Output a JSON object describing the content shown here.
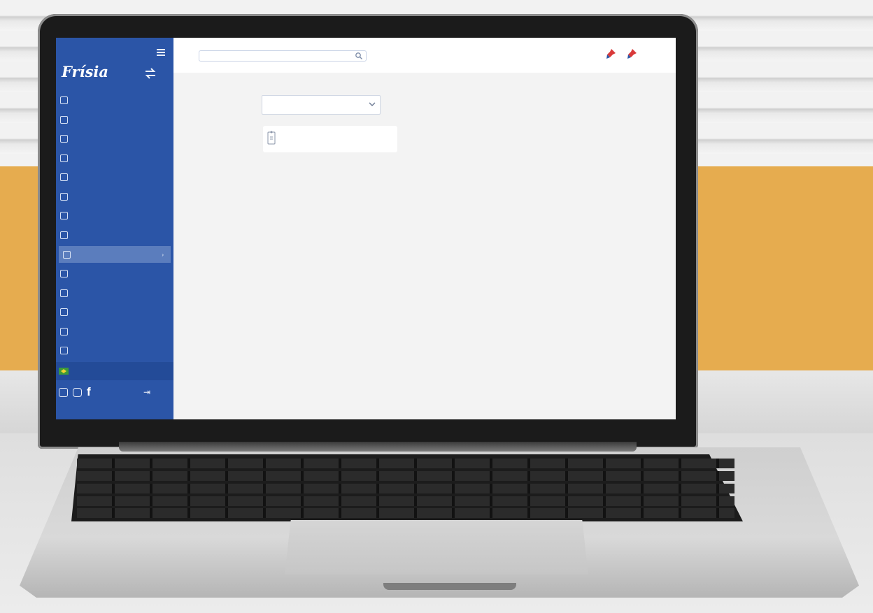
{
  "brand": {
    "name": "Frísia"
  },
  "search": {
    "placeholder": ""
  },
  "sidebar": {
    "items": [
      {
        "label": "",
        "icon": "home-icon"
      },
      {
        "label": "",
        "icon": "clock-icon"
      },
      {
        "label": "",
        "icon": "gear-icon"
      },
      {
        "label": "",
        "icon": "grid-icon"
      },
      {
        "label": "",
        "icon": "document-icon"
      },
      {
        "label": "",
        "icon": "chart-icon"
      },
      {
        "label": "",
        "icon": "tag-icon"
      },
      {
        "label": "",
        "icon": "lock-icon"
      },
      {
        "label": "",
        "icon": "folder-icon",
        "active": true,
        "chevron": "›"
      },
      {
        "label": "",
        "icon": "bell-icon"
      },
      {
        "label": "",
        "icon": "settings-icon"
      },
      {
        "label": "",
        "icon": "calendar-icon"
      },
      {
        "label": "",
        "icon": "mail-icon"
      },
      {
        "label": "",
        "icon": "support-icon"
      }
    ],
    "membership": {
      "label": "",
      "icon": "flag-icon"
    },
    "social": {
      "facebook": "f"
    }
  },
  "select": {
    "value": ""
  },
  "card": {
    "label": "",
    "icon": "file-icon"
  },
  "colors": {
    "sidebar": "#2b55a7",
    "active_item": "#5b7dbd",
    "accent_band": "#e6ac4f",
    "screen_bg": "#f3f3f3"
  }
}
